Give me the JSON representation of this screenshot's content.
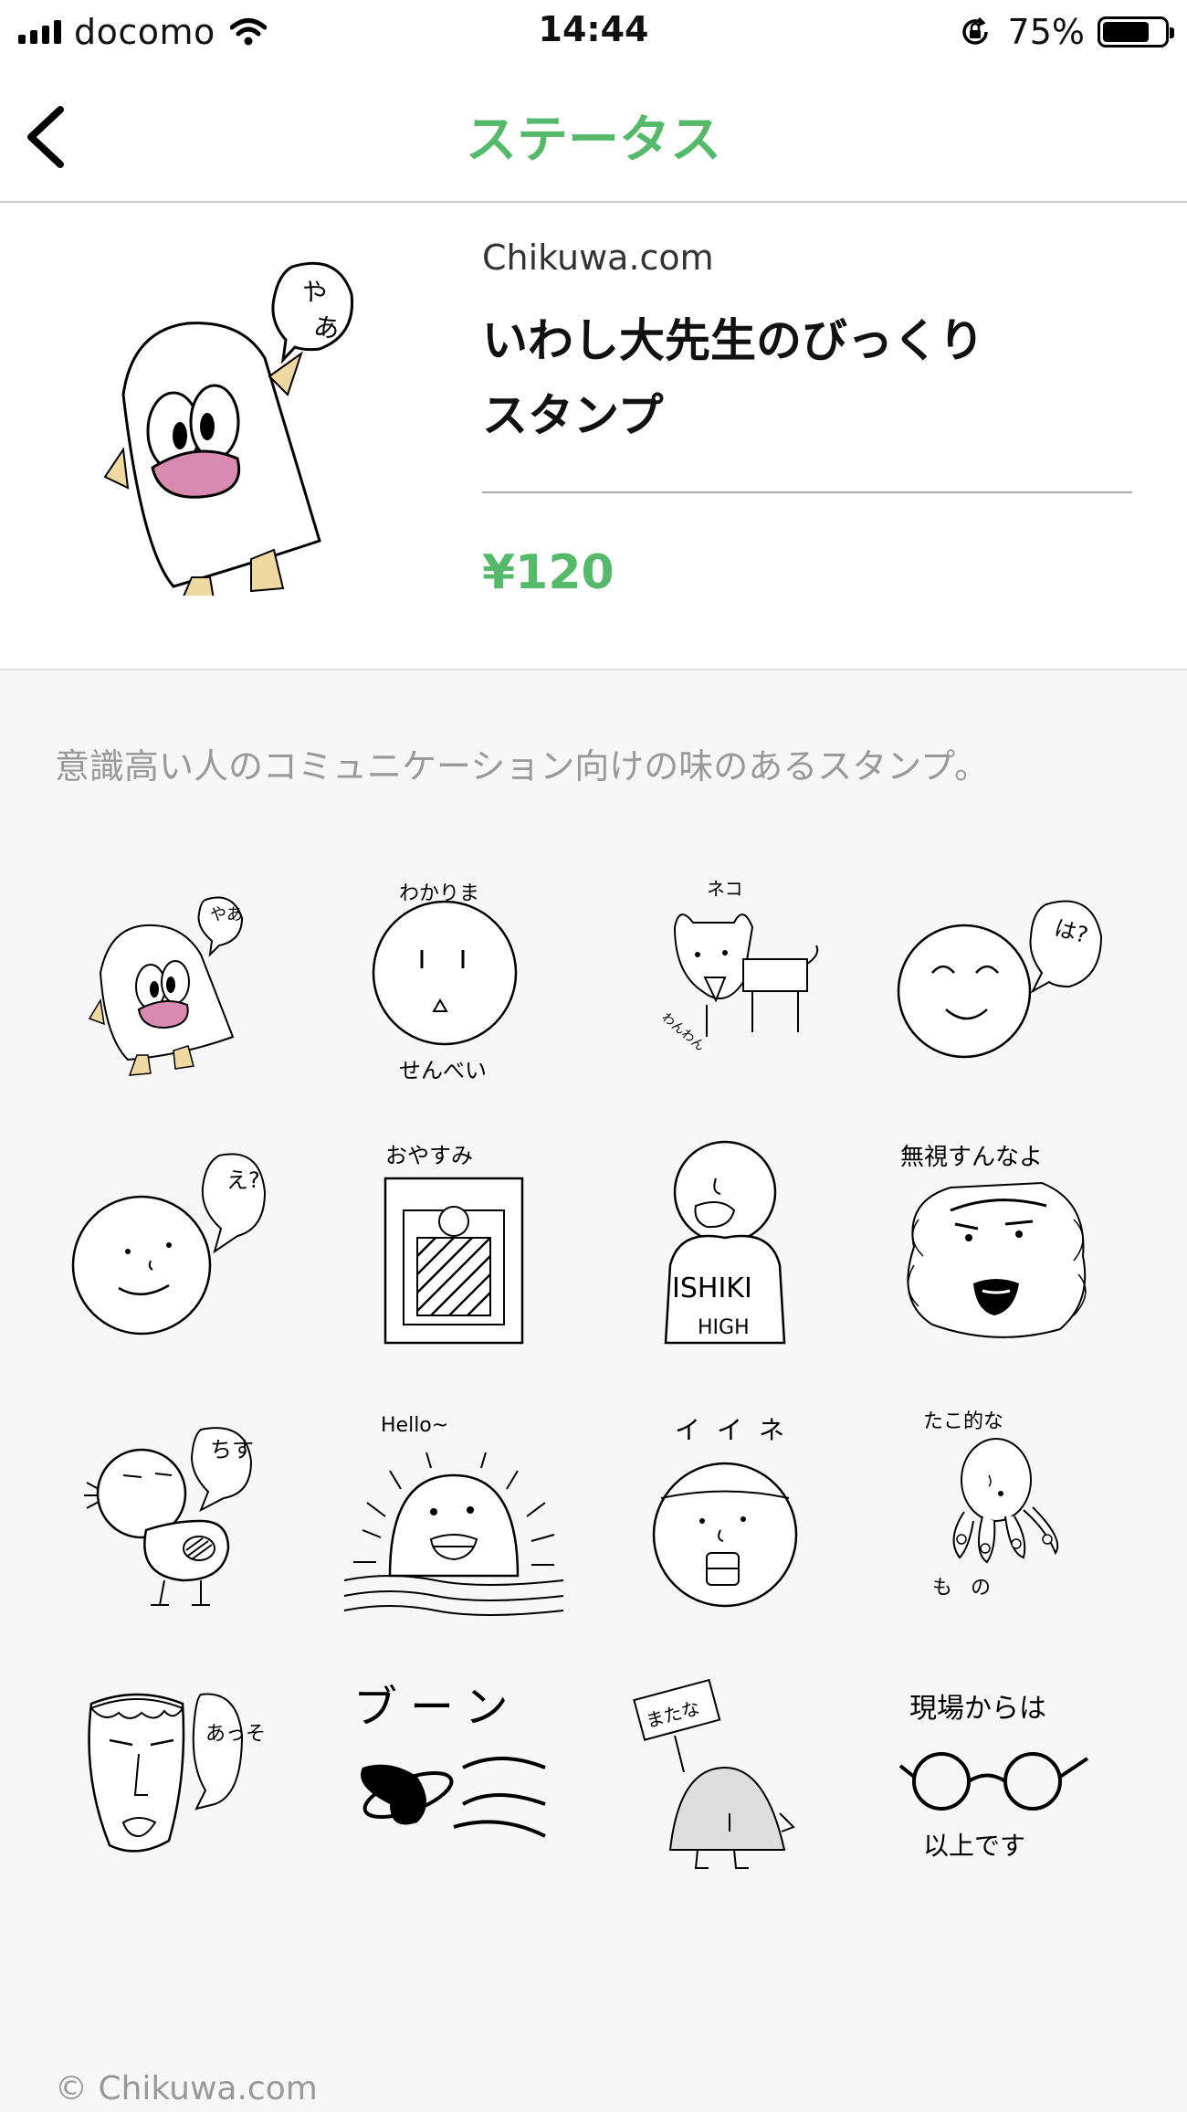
{
  "status_bar": {
    "carrier": "docomo",
    "time": "14:44",
    "battery_percent": "75%",
    "battery_level": 0.75
  },
  "nav": {
    "title": "ステータス"
  },
  "product": {
    "seller": "Chikuwa.com",
    "name_line1": "いわし大先生のびっくり",
    "name_line2": "スタンプ",
    "price": "¥120"
  },
  "description": "意識高い人のコミュニケーション向けの味のあるスタンプ。",
  "stickers": [
    {
      "icon": "penguin-yaa-sticker",
      "text": "やあ"
    },
    {
      "icon": "senbei-face-sticker",
      "text": "わかりま",
      "text2": "せんべい"
    },
    {
      "icon": "cat-dog-sticker",
      "text": "ネコ",
      "text2": "わんわん"
    },
    {
      "icon": "smile-ha-sticker",
      "text": "は?"
    },
    {
      "icon": "face-e-sticker",
      "text": "え?"
    },
    {
      "icon": "oyasumi-sticker",
      "text": "おやすみ"
    },
    {
      "icon": "ishiki-high-sticker",
      "text": "ISHIKI",
      "text2": "HIGH"
    },
    {
      "icon": "ignore-sticker",
      "text": "無視すんなよ"
    },
    {
      "icon": "bird-chisu-sticker",
      "text": "ちす"
    },
    {
      "icon": "hello-sun-sticker",
      "text": "Hello~"
    },
    {
      "icon": "iine-sticker",
      "text": "イイネ"
    },
    {
      "icon": "octopus-sticker",
      "text": "たこ的な",
      "text2": "もの"
    },
    {
      "icon": "aso-face-sticker",
      "text": "あっそ"
    },
    {
      "icon": "buun-sticker",
      "text": "ブーン"
    },
    {
      "icon": "matana-sticker",
      "text": "またな"
    },
    {
      "icon": "glasses-sticker",
      "text": "現場からは",
      "text2": "以上です"
    }
  ],
  "copyright": "© Chikuwa.com",
  "colors": {
    "accent": "#55b96a",
    "mouth_pink": "#d98ab0",
    "feet_tan": "#f0d9a0"
  }
}
